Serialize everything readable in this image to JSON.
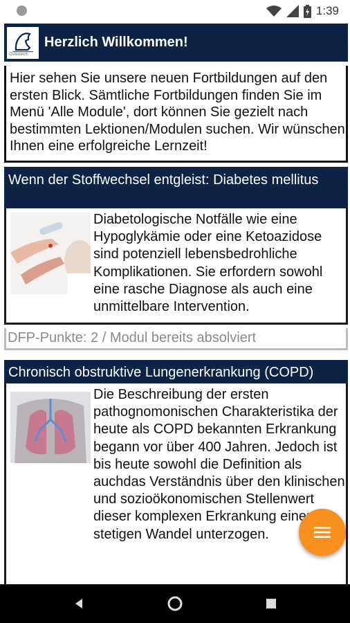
{
  "status": {
    "time": "1:39"
  },
  "welcome": {
    "title": "Herzlich Willkommen!",
    "logo_text": "Österreich",
    "text": "Hier sehen Sie unsere neuen Fortbildungen auf den ersten Blick. Sämtliche Fortbildungen finden Sie im Menü 'Alle Module', dort können Sie gezielt nach bestimmten Lektionen/Modulen suchen. Wir wünschen Ihnen eine erfolgreiche Lernzeit!"
  },
  "modules": [
    {
      "title": "Wenn der Stoffwechsel entgleist: Diabetes mellitus",
      "description": "Diabetologische Notfälle wie eine Hypoglykämie oder eine Ketoazidose sind potenziell lebensbedrohliche Komplikationen. Sie erfordern sowohl eine rasche Diagnose als auch eine unmittelbare Intervention.",
      "status": "DFP-Punkte: 2 / Modul bereits absolviert"
    },
    {
      "title": "Chronisch obstruktive Lungenerkrankung (COPD)",
      "description": "Die Beschreibung der ersten pathognomonischen Charakteristika der heute als COPD bekannten Erkrankung begann vor über 400 Jahren. Jedoch ist bis heute sowohl die Definition als auchdas Verständnis über den klinischen und sozioökonomischen Stellenwert dieser komplexen Erkrankung einem stetigen Wandel unterzogen."
    }
  ],
  "icons": {
    "fab": "menu-icon",
    "nav": [
      "back-icon",
      "home-icon",
      "recents-icon"
    ]
  },
  "colors": {
    "header_bg": "#0d2446",
    "fab": "#f7901e",
    "navbar": "#000000"
  }
}
